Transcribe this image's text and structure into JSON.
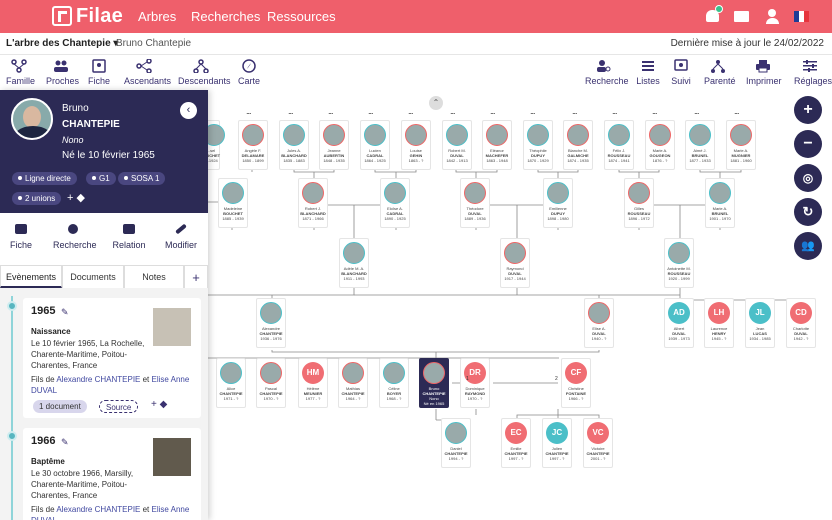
{
  "app": {
    "name": "Filae",
    "brand_color": "#ef5f6b",
    "dark_color": "#2c2a55"
  },
  "topnav": [
    "Arbres",
    "Recherches",
    "Ressources"
  ],
  "subbar": {
    "tree": "L'arbre des Chantepie",
    "person": "Bruno Chantepie",
    "last_update": "Dernière mise à jour le 24/02/2022"
  },
  "toolbar_left": [
    "Famille",
    "Proches",
    "Fiche",
    "Ascendants",
    "Descendants",
    "Carte"
  ],
  "toolbar_right": [
    "Recherche",
    "Listes",
    "Suivi",
    "Parenté",
    "Imprimer",
    "Réglages"
  ],
  "panel": {
    "first": "Bruno",
    "last": "CHANTEPIE",
    "nick": "Nono",
    "born": "Né le 10 février 1965",
    "chips": [
      "Ligne directe",
      "G1",
      "SOSA 1",
      "2 unions"
    ],
    "actions": [
      "Fiche",
      "Recherche",
      "Relation",
      "Modifier"
    ],
    "tabs": [
      "Evènements",
      "Documents",
      "Notes",
      "+"
    ],
    "events": [
      {
        "year": "1965",
        "type": "Naissance",
        "desc": "Le 10 février 1965, La Rochelle, Charente-Maritime, Poitou-Charentes, France",
        "fils": "Fils de",
        "father": "Alexandre CHANTEPIE",
        "and": "et",
        "mother": "Elise Anne DUVAL",
        "doc": "1 document",
        "source": "Source"
      },
      {
        "year": "1966",
        "type": "Baptême",
        "desc": "Le 30 octobre 1966, Marsilly, Charente-Maritime, Poitou-Charentes, France",
        "fils": "Fils de",
        "father": "Alexandre CHANTEPIE",
        "and": "et",
        "mother": "Elise Anne DUVAL"
      }
    ]
  },
  "tree": {
    "dots": "...",
    "gen5": [
      {
        "n1": "...sel",
        "n2": "...UCHET",
        "d": "...-1924"
      },
      {
        "n1": "Angèle F.",
        "n2": "DELAMARE",
        "d": "1850 - 1899"
      },
      {
        "n1": "Jules A.",
        "n2": "BLANCHARD",
        "d": "1835 - 1883"
      },
      {
        "n1": "Jeanne",
        "n2": "AUBERTIN",
        "d": "1848 - 1935"
      },
      {
        "n1": "Lucien",
        "n2": "CADRAL",
        "d": "1864 - 1925"
      },
      {
        "n1": "Louise",
        "n2": "GEHIN",
        "d": "1863 - ?"
      },
      {
        "n1": "Robert M.",
        "n2": "DUVAL",
        "d": "1842 - 1913"
      },
      {
        "n1": "Eléanor",
        "n2": "MACHEFER",
        "d": "1863 - 1948"
      },
      {
        "n1": "Théophile",
        "n2": "DUPUY",
        "d": "1870 - 1929"
      },
      {
        "n1": "Blanche M.",
        "n2": "GALMICHE",
        "d": "1874 - 1935"
      },
      {
        "n1": "Félix J.",
        "n2": "ROUSSEAU",
        "d": "1874 - 1941"
      },
      {
        "n1": "Marie A.",
        "n2": "GOUGEON",
        "d": "1876 - ?"
      },
      {
        "n1": "Aimé J.",
        "n2": "BRUNEL",
        "d": "1877 - 1933"
      },
      {
        "n1": "Marie A.",
        "n2": "MUGNIER",
        "d": "1881 - 1960"
      }
    ],
    "gen4": [
      {
        "n1": "Madeleine",
        "n2": "BOUCHET",
        "d": "1885 - 1939"
      },
      {
        "n1": "Robert J.",
        "n2": "BLANCHARD",
        "d": "1871 - 1966"
      },
      {
        "n1": "Eloïse A.",
        "n2": "CADRAL",
        "d": "1890 - 1925"
      },
      {
        "n1": "Théodore",
        "n2": "DUVAL",
        "d": "1889 - 1936"
      },
      {
        "n1": "Emilienne",
        "n2": "DUPUY",
        "d": "1898 - 1980"
      },
      {
        "n1": "Gilles",
        "n2": "ROUSSEAU",
        "d": "1896 - 1972"
      },
      {
        "n1": "Marie A.",
        "n2": "BRUNEL",
        "d": "1901 - 1970"
      }
    ],
    "gen3": [
      {
        "n1": "Adèle M. A.",
        "n2": "BLANCHARD",
        "d": "1911 - 1993"
      },
      {
        "n1": "Raymond",
        "n2": "DUVAL",
        "d": "1917 - 1944"
      },
      {
        "n1": "Antoinette M.",
        "n2": "ROUSSEAU",
        "d": "1920 - 1999"
      }
    ],
    "gen2": [
      {
        "n1": "Alexandre",
        "n2": "CHANTEPIE",
        "d": "1936 - 1976"
      },
      {
        "n1": "Elise A.",
        "n2": "DUVAL",
        "d": "1940 - ?"
      },
      {
        "n1": "Albert",
        "n2": "DUVAL",
        "d": "1939 - 1973",
        "ini": "AD"
      },
      {
        "n1": "Laurence",
        "n2": "HENRY",
        "d": "1945 - ?",
        "ini": "LH"
      },
      {
        "n1": "Jean",
        "n2": "LUCAS",
        "d": "1934 - 1985",
        "ini": "JL"
      },
      {
        "n1": "Charlotte",
        "n2": "DUVAL",
        "d": "1942 - ?",
        "ini": "CD"
      }
    ],
    "gen1": [
      {
        "n1": "Alice",
        "n2": "CHANTEPIE",
        "d": "1971 - ?"
      },
      {
        "n1": "Pascal",
        "n2": "CHANTEPIE",
        "d": "1970 - ?"
      },
      {
        "n1": "Hélène",
        "n2": "MEUNIER",
        "d": "1977 - ?",
        "ini": "HM"
      },
      {
        "n1": "Mathias",
        "n2": "CHANTEPIE",
        "d": "1964 - ?"
      },
      {
        "n1": "Céline",
        "n2": "BOYER",
        "d": "1968 - ?"
      },
      {
        "n1": "Bruno",
        "n2": "CHANTEPIE",
        "d": "Nono",
        "d2": "Né en 1965"
      },
      {
        "n1": "Dominique",
        "n2": "RAYMOND",
        "d": "1970 - ?",
        "ini": "DR"
      },
      {
        "n1": "Christine",
        "n2": "FONTAINE",
        "d": "1966 - ?",
        "ini": "CF"
      }
    ],
    "gen0": [
      {
        "n1": "Daniel",
        "n2": "CHANTEPIE",
        "d": "1994 - ?"
      },
      {
        "n1": "Emilie",
        "n2": "CHANTEPIE",
        "d": "1997 - ?",
        "ini": "EC"
      },
      {
        "n1": "Julien",
        "n2": "CHANTEPIE",
        "d": "1997 - ?",
        "ini": "JC"
      },
      {
        "n1": "Victoire",
        "n2": "CHANTEPIE",
        "d": "2001 - ?",
        "ini": "VC"
      }
    ],
    "union_num_1": "1",
    "union_num_2": "2"
  },
  "zoom_buttons": [
    "+",
    "−"
  ]
}
